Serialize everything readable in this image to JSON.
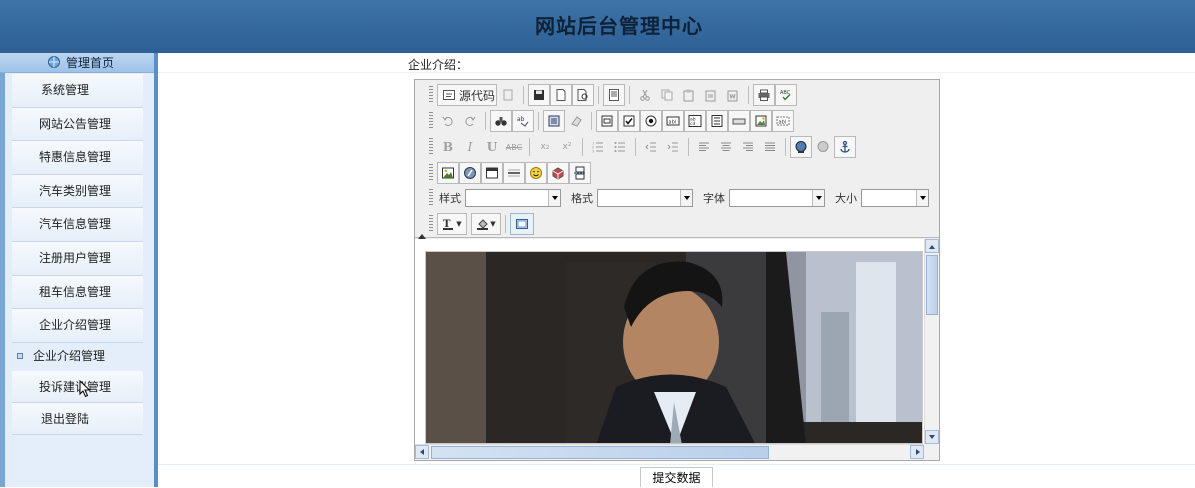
{
  "header": {
    "title": "网站后台管理中心"
  },
  "sidebar": {
    "home_label": "管理首页",
    "items": [
      {
        "label": "系统管理"
      },
      {
        "label": "网站公告管理"
      },
      {
        "label": "特惠信息管理"
      },
      {
        "label": "汽车类别管理"
      },
      {
        "label": "汽车信息管理"
      },
      {
        "label": "注册用户管理"
      },
      {
        "label": "租车信息管理"
      },
      {
        "label": "企业介绍管理"
      },
      {
        "label": "企业介绍管理"
      },
      {
        "label": "投诉建议管理"
      },
      {
        "label": "退出登陆"
      }
    ]
  },
  "form": {
    "field_label": "企业介绍：",
    "submit_label": "提交数据"
  },
  "editor": {
    "source_label": "源代码",
    "style_label": "样式",
    "format_label": "格式",
    "font_label": "字体",
    "size_label": "大小",
    "bold": "B",
    "italic": "I",
    "underline": "U",
    "strike": "ABC",
    "text_color": "T",
    "spellcheck": "ABC",
    "sub": "x₂",
    "sup": "x²"
  },
  "colors": {
    "header_bg": "#3e74a8",
    "sidebar_bg": "#e3eefa",
    "accent": "#5a8ec8"
  }
}
